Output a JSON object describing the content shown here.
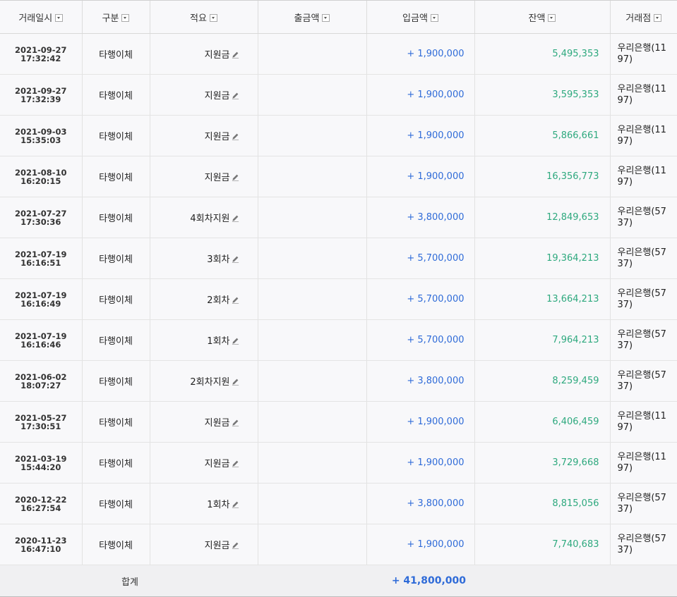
{
  "columns": {
    "datetime": "거래일시",
    "kind": "구분",
    "memo": "적요",
    "withdrawal": "출금액",
    "deposit": "입금액",
    "balance": "잔액",
    "branch": "거래점"
  },
  "rows": [
    {
      "date": "2021-09-27",
      "time": "17:32:42",
      "kind": "타행이체",
      "memo": "지원금",
      "withdrawal": "",
      "deposit": "+ 1,900,000",
      "balance": "5,495,353",
      "branch": "우리은행(1197)"
    },
    {
      "date": "2021-09-27",
      "time": "17:32:39",
      "kind": "타행이체",
      "memo": "지원금",
      "withdrawal": "",
      "deposit": "+ 1,900,000",
      "balance": "3,595,353",
      "branch": "우리은행(1197)"
    },
    {
      "date": "2021-09-03",
      "time": "15:35:03",
      "kind": "타행이체",
      "memo": "지원금",
      "withdrawal": "",
      "deposit": "+ 1,900,000",
      "balance": "5,866,661",
      "branch": "우리은행(1197)"
    },
    {
      "date": "2021-08-10",
      "time": "16:20:15",
      "kind": "타행이체",
      "memo": "지원금",
      "withdrawal": "",
      "deposit": "+ 1,900,000",
      "balance": "16,356,773",
      "branch": "우리은행(1197)"
    },
    {
      "date": "2021-07-27",
      "time": "17:30:36",
      "kind": "타행이체",
      "memo": "4회차지원",
      "withdrawal": "",
      "deposit": "+ 3,800,000",
      "balance": "12,849,653",
      "branch": "우리은행(5737)"
    },
    {
      "date": "2021-07-19",
      "time": "16:16:51",
      "kind": "타행이체",
      "memo": "3회차",
      "withdrawal": "",
      "deposit": "+ 5,700,000",
      "balance": "19,364,213",
      "branch": "우리은행(5737)"
    },
    {
      "date": "2021-07-19",
      "time": "16:16:49",
      "kind": "타행이체",
      "memo": "2회차",
      "withdrawal": "",
      "deposit": "+ 5,700,000",
      "balance": "13,664,213",
      "branch": "우리은행(5737)"
    },
    {
      "date": "2021-07-19",
      "time": "16:16:46",
      "kind": "타행이체",
      "memo": "1회차",
      "withdrawal": "",
      "deposit": "+ 5,700,000",
      "balance": "7,964,213",
      "branch": "우리은행(5737)"
    },
    {
      "date": "2021-06-02",
      "time": "18:07:27",
      "kind": "타행이체",
      "memo": "2회차지원",
      "withdrawal": "",
      "deposit": "+ 3,800,000",
      "balance": "8,259,459",
      "branch": "우리은행(5737)"
    },
    {
      "date": "2021-05-27",
      "time": "17:30:51",
      "kind": "타행이체",
      "memo": "지원금",
      "withdrawal": "",
      "deposit": "+ 1,900,000",
      "balance": "6,406,459",
      "branch": "우리은행(1197)"
    },
    {
      "date": "2021-03-19",
      "time": "15:44:20",
      "kind": "타행이체",
      "memo": "지원금",
      "withdrawal": "",
      "deposit": "+ 1,900,000",
      "balance": "3,729,668",
      "branch": "우리은행(1197)"
    },
    {
      "date": "2020-12-22",
      "time": "16:27:54",
      "kind": "타행이체",
      "memo": "1회차",
      "withdrawal": "",
      "deposit": "+ 3,800,000",
      "balance": "8,815,056",
      "branch": "우리은행(5737)"
    },
    {
      "date": "2020-11-23",
      "time": "16:47:10",
      "kind": "타행이체",
      "memo": "지원금",
      "withdrawal": "",
      "deposit": "+ 1,900,000",
      "balance": "7,740,683",
      "branch": "우리은행(5737)"
    }
  ],
  "footer": {
    "label": "합계",
    "deposit_total": "+ 41,800,000"
  },
  "icons": {
    "sort": "dropdown-sort-icon",
    "edit": "pencil-edit-icon"
  },
  "colors": {
    "deposit": "#2f6bd8",
    "balance": "#2ea97e"
  }
}
